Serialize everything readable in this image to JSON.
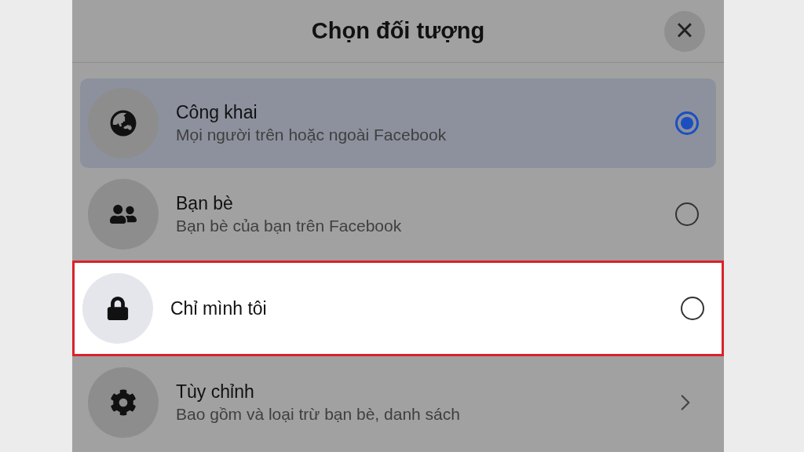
{
  "dialog": {
    "title": "Chọn đối tượng",
    "close": "×"
  },
  "options": [
    {
      "kind": "radio",
      "title": "Công khai",
      "subtitle": "Mọi người trên hoặc ngoài Facebook",
      "selected": true,
      "highlighted": false
    },
    {
      "kind": "radio",
      "title": "Bạn bè",
      "subtitle": "Bạn bè của bạn trên Facebook",
      "selected": false,
      "highlighted": false
    },
    {
      "kind": "radio",
      "title": "Chỉ mình tôi",
      "selected": false,
      "highlighted": true
    },
    {
      "kind": "link",
      "title": "Tùy chỉnh",
      "subtitle": "Bao gồm và loại trừ bạn bè, danh sách",
      "selected": false,
      "highlighted": false
    }
  ]
}
